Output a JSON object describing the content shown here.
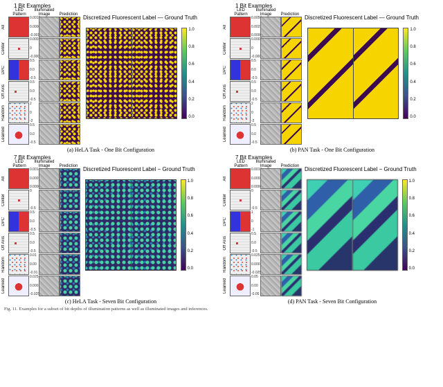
{
  "panels": [
    {
      "title_examples": "1 Bit Examples",
      "headers": {
        "led": "LED Pattern",
        "ill": "Illuminated Image",
        "pred": "Prediction"
      },
      "big_title": "Discretized Fluorescent\nLabel — Ground Truth",
      "caption": "(a) HeLA Task - One Bit Configuration"
    },
    {
      "title_examples": "1 Bit Examples",
      "headers": {
        "led": "LED Pattern",
        "ill": "Illuminated Image",
        "pred": "Prediction"
      },
      "big_title": "Discretized Fluorescent\nLabel — Ground Truth",
      "caption": "(b) PAN Task - One Bit Configuration"
    },
    {
      "title_examples": "7 Bit Examples",
      "headers": {
        "led": "LED Pattern",
        "ill": "Illuminated Image",
        "pred": "Prediction"
      },
      "big_title": "Discretized Fluorescent\nLabel − Ground Truth",
      "caption": "(c) HeLA Task - Seven Bit Configuration"
    },
    {
      "title_examples": "7 Bit Examples",
      "headers": {
        "led": "LED Pattern",
        "ill": "Illuminated Image",
        "pred": "Prediction"
      },
      "big_title": "Discretized Fluorescent\nLabel − Ground Truth",
      "caption": "(d) PAN Task - Seven Bit Configuration"
    }
  ],
  "row_labels": [
    "All",
    "Center",
    "DPC",
    "Off Axis",
    "Random",
    "Learned"
  ],
  "ticks": {
    "a_all": [
      "0.0015",
      "0.0000",
      "-0.0015"
    ],
    "a_center": [
      "0.0001",
      "0",
      "-0.0001"
    ],
    "a_dpc": [
      "0.5",
      "0.0",
      "-0.5"
    ],
    "a_off": [
      "0.5",
      "0.0",
      "-0.5"
    ],
    "a_rand": [
      "2",
      "0",
      "-2"
    ],
    "a_learn": [
      "0.5",
      "0.0",
      "-0.5"
    ],
    "b_all": [
      "0.0050",
      "0.0025",
      "0.0000"
    ],
    "b_center": [
      "0.0002",
      "0",
      "-0.0002"
    ],
    "b_dpc": [
      "0.5",
      "0.0",
      "-0.5"
    ],
    "b_off": [
      "0.5",
      "0.0",
      "-0.5"
    ],
    "b_rand": [
      "2",
      "0",
      "-2"
    ],
    "b_learn": [
      "0.5",
      "0.0",
      "-0.5"
    ],
    "c_all": [
      "0.0014",
      "0.0007",
      "0.0000"
    ],
    "c_center": [
      "0",
      "-0.5"
    ],
    "c_dpc": [
      "0.5",
      "0.0",
      "-0.5"
    ],
    "c_off": [
      "0.5",
      "0.0",
      "-0.5"
    ],
    "c_rand": [
      "0.01",
      "0.00",
      "-0.01"
    ],
    "c_learn": [
      "0.025",
      "0.000",
      "-0.025"
    ],
    "d_all": [
      "0.0016",
      "0.0008",
      "0.0000"
    ],
    "d_center": [
      "0",
      "-0.5"
    ],
    "d_dpc": [
      "1",
      "0",
      "-1"
    ],
    "d_off": [
      "0.5",
      "0.0",
      "-0.5"
    ],
    "d_rand": [
      "0.025",
      "0.000",
      "-0.025"
    ],
    "d_learn": [
      "0.05",
      "0.00",
      "-0.05"
    ]
  },
  "colorbar_labels": [
    "1.0",
    "0.8",
    "0.6",
    "0.4",
    "0.2",
    "0.0"
  ],
  "footer_caption": "Fig. 11. Examples for a subset of bit depths of illumination patterns as well as illuminated images and inferences."
}
